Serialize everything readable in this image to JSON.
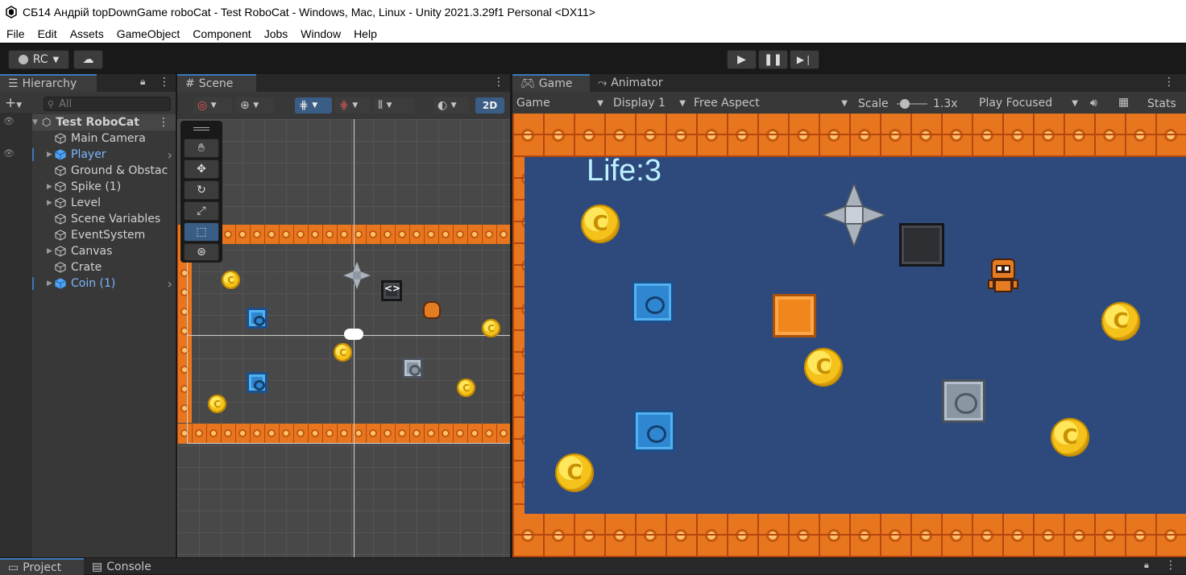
{
  "window": {
    "title": "СБ14 Андрій topDownGame roboCat - Test RoboCat - Windows, Mac, Linux - Unity 2021.3.29f1 Personal <DX11>"
  },
  "menu": [
    "File",
    "Edit",
    "Assets",
    "GameObject",
    "Component",
    "Jobs",
    "Window",
    "Help"
  ],
  "toolbar": {
    "account": "RC",
    "play_icon": "play-icon",
    "pause_icon": "pause-icon",
    "step_icon": "step-icon"
  },
  "hierarchy": {
    "tab": "Hierarchy",
    "search_placeholder": "All",
    "scene": "Test RoboCat",
    "items": [
      {
        "label": "Main Camera",
        "prefab": false,
        "expandable": false
      },
      {
        "label": "Player",
        "prefab": true,
        "expandable": true
      },
      {
        "label": "Ground & Obstac",
        "prefab": false,
        "expandable": false
      },
      {
        "label": "Spike (1)",
        "prefab": false,
        "expandable": true
      },
      {
        "label": "Level",
        "prefab": false,
        "expandable": true
      },
      {
        "label": "Scene Variables",
        "prefab": false,
        "expandable": false
      },
      {
        "label": "EventSystem",
        "prefab": false,
        "expandable": false
      },
      {
        "label": "Canvas",
        "prefab": false,
        "expandable": true
      },
      {
        "label": "Crate",
        "prefab": false,
        "expandable": false
      },
      {
        "label": "Coin (1)",
        "prefab": true,
        "expandable": true
      }
    ]
  },
  "scene": {
    "tab": "Scene",
    "mode_2d": "2D"
  },
  "game": {
    "tabs": [
      "Game",
      "Animator"
    ],
    "view_select": "Game",
    "display_select": "Display 1",
    "aspect_select": "Free Aspect",
    "scale_label": "Scale",
    "scale_value": "1.3x",
    "scale_fraction": 0.15,
    "play_focused": "Play Focused",
    "stats": "Stats",
    "life_text": "Life:3"
  },
  "bottom": {
    "tabs": [
      "Project",
      "Console"
    ]
  },
  "colors": {
    "game_bg": "#2e4a7c",
    "brick": "#e8761e",
    "editor_bg": "#383838",
    "accent": "#3a79bb",
    "prefab_text": "#7cb8ff"
  }
}
